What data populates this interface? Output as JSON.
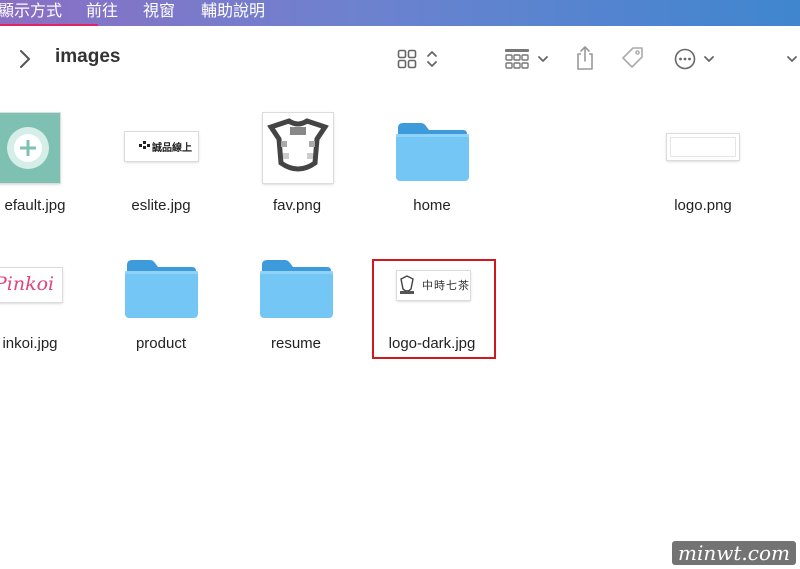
{
  "menubar": {
    "items": [
      "顯示方式",
      "前往",
      "視窗",
      "輔助說明"
    ]
  },
  "toolbar": {
    "title": "images",
    "icons": {
      "back": "chevron-right-icon",
      "view_grid": "grid-view-icon",
      "view_sort": "sort-updown-icon",
      "group": "group-by-icon",
      "share": "share-icon",
      "tag": "tag-icon",
      "more": "more-actions-icon"
    }
  },
  "files": [
    {
      "name": "efault.jpg",
      "kind": "image"
    },
    {
      "name": "eslite.jpg",
      "kind": "image"
    },
    {
      "name": "fav.png",
      "kind": "image"
    },
    {
      "name": "home",
      "kind": "folder"
    },
    {
      "name": "logo.png",
      "kind": "image"
    },
    {
      "name": "inkoi.jpg",
      "kind": "image"
    },
    {
      "name": "product",
      "kind": "folder"
    },
    {
      "name": "resume",
      "kind": "folder"
    },
    {
      "name": "logo-dark.jpg",
      "kind": "image",
      "selected": true
    }
  ],
  "thumbnails": {
    "eslite_text": "誠品線上",
    "pinkoi_text": "Pinkoi",
    "logo_dark_text": "中時七茶"
  },
  "colors": {
    "folder_light": "#74c6f5",
    "folder_dark": "#3d9bdc",
    "selection": "#d0191f",
    "menubar_left": "#8a6fc4",
    "menubar_right": "#3f86cf"
  },
  "watermark": "minwt.com"
}
